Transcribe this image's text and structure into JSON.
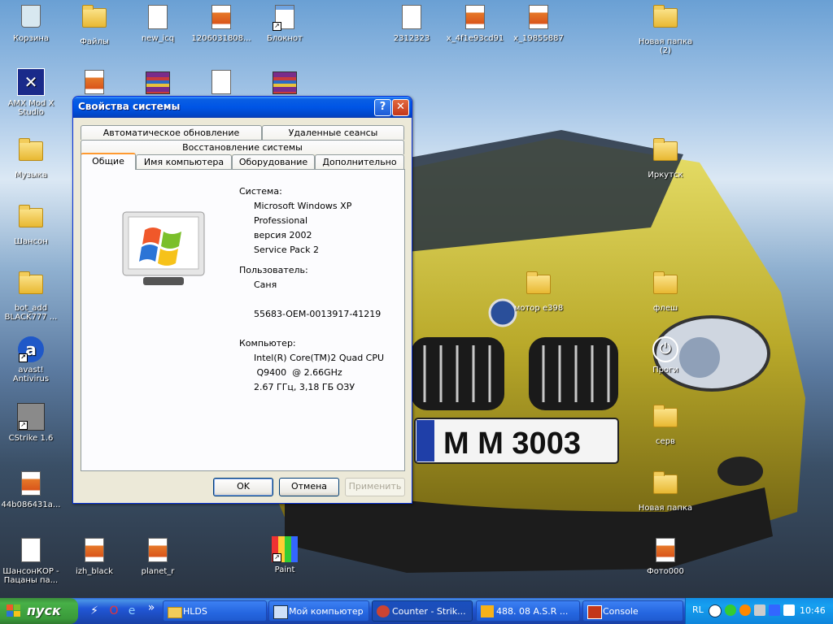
{
  "desktop": {
    "icons": [
      {
        "label": "Корзина",
        "type": "recycle"
      },
      {
        "label": "Файлы",
        "type": "folder"
      },
      {
        "label": "new_icq",
        "type": "audio"
      },
      {
        "label": "1206031808...",
        "type": "image"
      },
      {
        "label": "Блокнот",
        "type": "notepad"
      },
      {
        "label": "2312323",
        "type": "doc"
      },
      {
        "label": "x_4f1e93cd91",
        "type": "image"
      },
      {
        "label": "x_19855887",
        "type": "image"
      },
      {
        "label": "Новая папка (2)",
        "type": "folder"
      },
      {
        "label": "AMX Mod X Studio",
        "type": "app"
      },
      {
        "label": "Музыка",
        "type": "folder"
      },
      {
        "label": "Иркутск",
        "type": "folder"
      },
      {
        "label": "Шансон",
        "type": "folder"
      },
      {
        "label": "bot_add BLACK777 ...",
        "type": "folder"
      },
      {
        "label": "мотор е398",
        "type": "folder"
      },
      {
        "label": "флеш",
        "type": "folder"
      },
      {
        "label": "avast! Antivirus",
        "type": "app"
      },
      {
        "label": "Проги",
        "type": "power"
      },
      {
        "label": "CStrike 1.6",
        "type": "game"
      },
      {
        "label": "серв",
        "type": "folder"
      },
      {
        "label": "44b086431a...",
        "type": "image"
      },
      {
        "label": "Новая папка",
        "type": "folder"
      },
      {
        "label": "ШансонКОР - Пацаны па...",
        "type": "audio"
      },
      {
        "label": "izh_black",
        "type": "image"
      },
      {
        "label": "planet_r",
        "type": "doc"
      },
      {
        "label": "Paint",
        "type": "paint"
      },
      {
        "label": "Фото000",
        "type": "image"
      }
    ],
    "plate_text": "M M 3003"
  },
  "dialog": {
    "title": "Свойства системы",
    "help_label": "?",
    "close_label": "✕",
    "tabs_row1": [
      "Автоматическое обновление",
      "Удаленные сеансы"
    ],
    "tabs_row2": [
      "Восстановление системы"
    ],
    "tabs_row3": [
      "Общие",
      "Имя компьютера",
      "Оборудование",
      "Дополнительно"
    ],
    "active_tab": "Общие",
    "system_label": "Система:",
    "system_lines": [
      "Microsoft Windows XP",
      "Professional",
      "версия 2002",
      "Service Pack 2"
    ],
    "user_label": "Пользователь:",
    "user_lines": [
      "Саня",
      "",
      "55683-OEM-0013917-41219"
    ],
    "computer_label": "Компьютер:",
    "computer_lines": [
      "Intel(R) Core(TM)2 Quad CPU",
      " Q9400  @ 2.66GHz",
      "2.67 ГГц, 3,18 ГБ ОЗУ"
    ],
    "buttons": {
      "ok": "OK",
      "cancel": "Отмена",
      "apply": "Применить"
    }
  },
  "taskbar": {
    "start_label": "пуск",
    "quicklaunch_more": "»",
    "tasks": [
      {
        "label": "HLDS",
        "icon": "folder-icon",
        "active": false
      },
      {
        "label": "Мой компьютер",
        "icon": "computer-icon",
        "active": false
      },
      {
        "label": "Counter - Strik...",
        "icon": "game-icon",
        "active": true
      },
      {
        "label": "488. 08 A.S.R ...",
        "icon": "winamp-icon",
        "active": false
      },
      {
        "label": "Console",
        "icon": "console-icon",
        "active": false
      }
    ],
    "language": "RL",
    "clock": "10:46"
  }
}
